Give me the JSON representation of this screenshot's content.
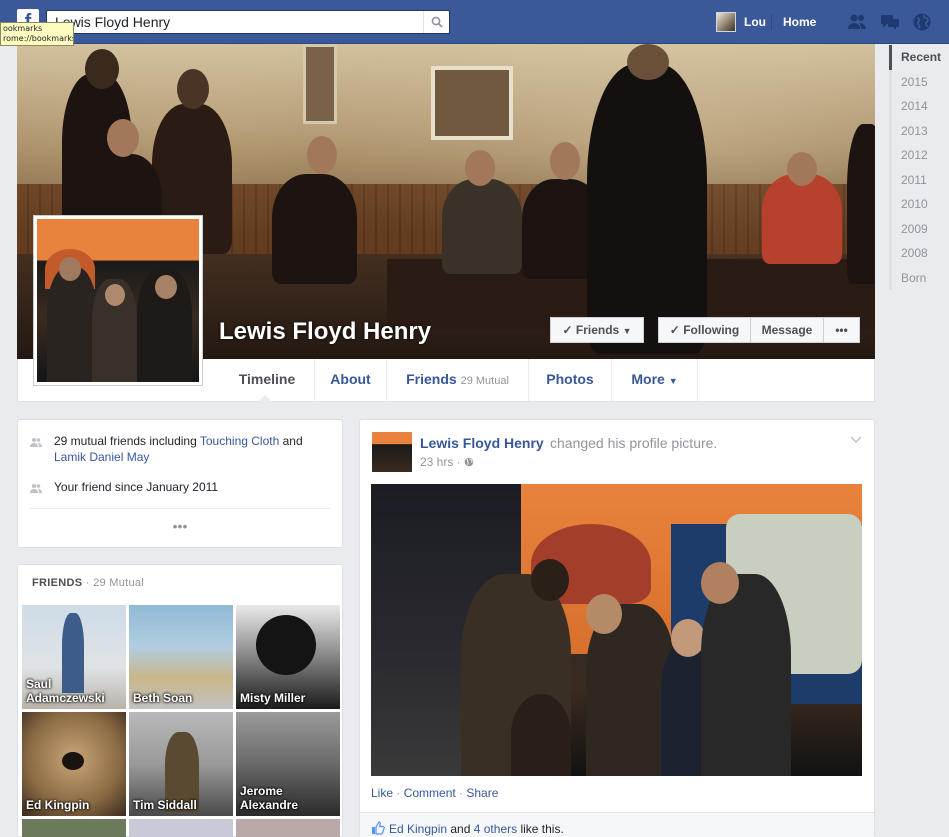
{
  "browser": {
    "tooltip_line1": "ookmarks",
    "tooltip_line2": "rome://bookmarks/"
  },
  "topbar": {
    "logo": "f",
    "search_value": "Lewis Floyd Henry",
    "user_name": "Lou",
    "home_label": "Home"
  },
  "profile": {
    "name": "Lewis Floyd Henry",
    "buttons": {
      "friends": "Friends",
      "following": "Following",
      "message": "Message",
      "more": "•••"
    }
  },
  "tabs": {
    "timeline": "Timeline",
    "about": "About",
    "friends": "Friends",
    "friends_sub": "29 Mutual",
    "photos": "Photos",
    "more": "More"
  },
  "intro": {
    "mutual_prefix": "29 mutual friends including ",
    "mutual_friend1": "Touching Cloth",
    "mutual_and": " and",
    "mutual_friend2": "Lamik Daniel May",
    "friend_since": "Your friend since January 2011",
    "more_dots": "•••"
  },
  "friends_box": {
    "title": "FRIENDS",
    "count": " · 29 Mutual",
    "tiles": [
      {
        "name_line1": "Saul",
        "name_line2": "Adamczewski"
      },
      {
        "name_line1": "",
        "name_line2": "Beth Soan"
      },
      {
        "name_line1": "",
        "name_line2": "Misty Miller"
      },
      {
        "name_line1": "",
        "name_line2": "Ed Kingpin"
      },
      {
        "name_line1": "",
        "name_line2": "Tim Siddall"
      },
      {
        "name_line1": "Jerome",
        "name_line2": "Alexandre"
      }
    ]
  },
  "post": {
    "author": "Lewis Floyd Henry",
    "action": "changed his profile picture.",
    "time": "23 hrs ·",
    "like": "Like",
    "comment": "Comment",
    "share": "Share",
    "sep": " · ",
    "likes_name": "Ed Kingpin",
    "likes_and": " and ",
    "likes_others": "4 others",
    "likes_suffix": " like this."
  },
  "years": [
    "Recent",
    "2015",
    "2014",
    "2013",
    "2012",
    "2011",
    "2010",
    "2009",
    "2008",
    "Born"
  ],
  "colors": {
    "brand": "#3b5998",
    "link": "#365899",
    "muted": "#90949c",
    "background": "#e9ebee"
  }
}
